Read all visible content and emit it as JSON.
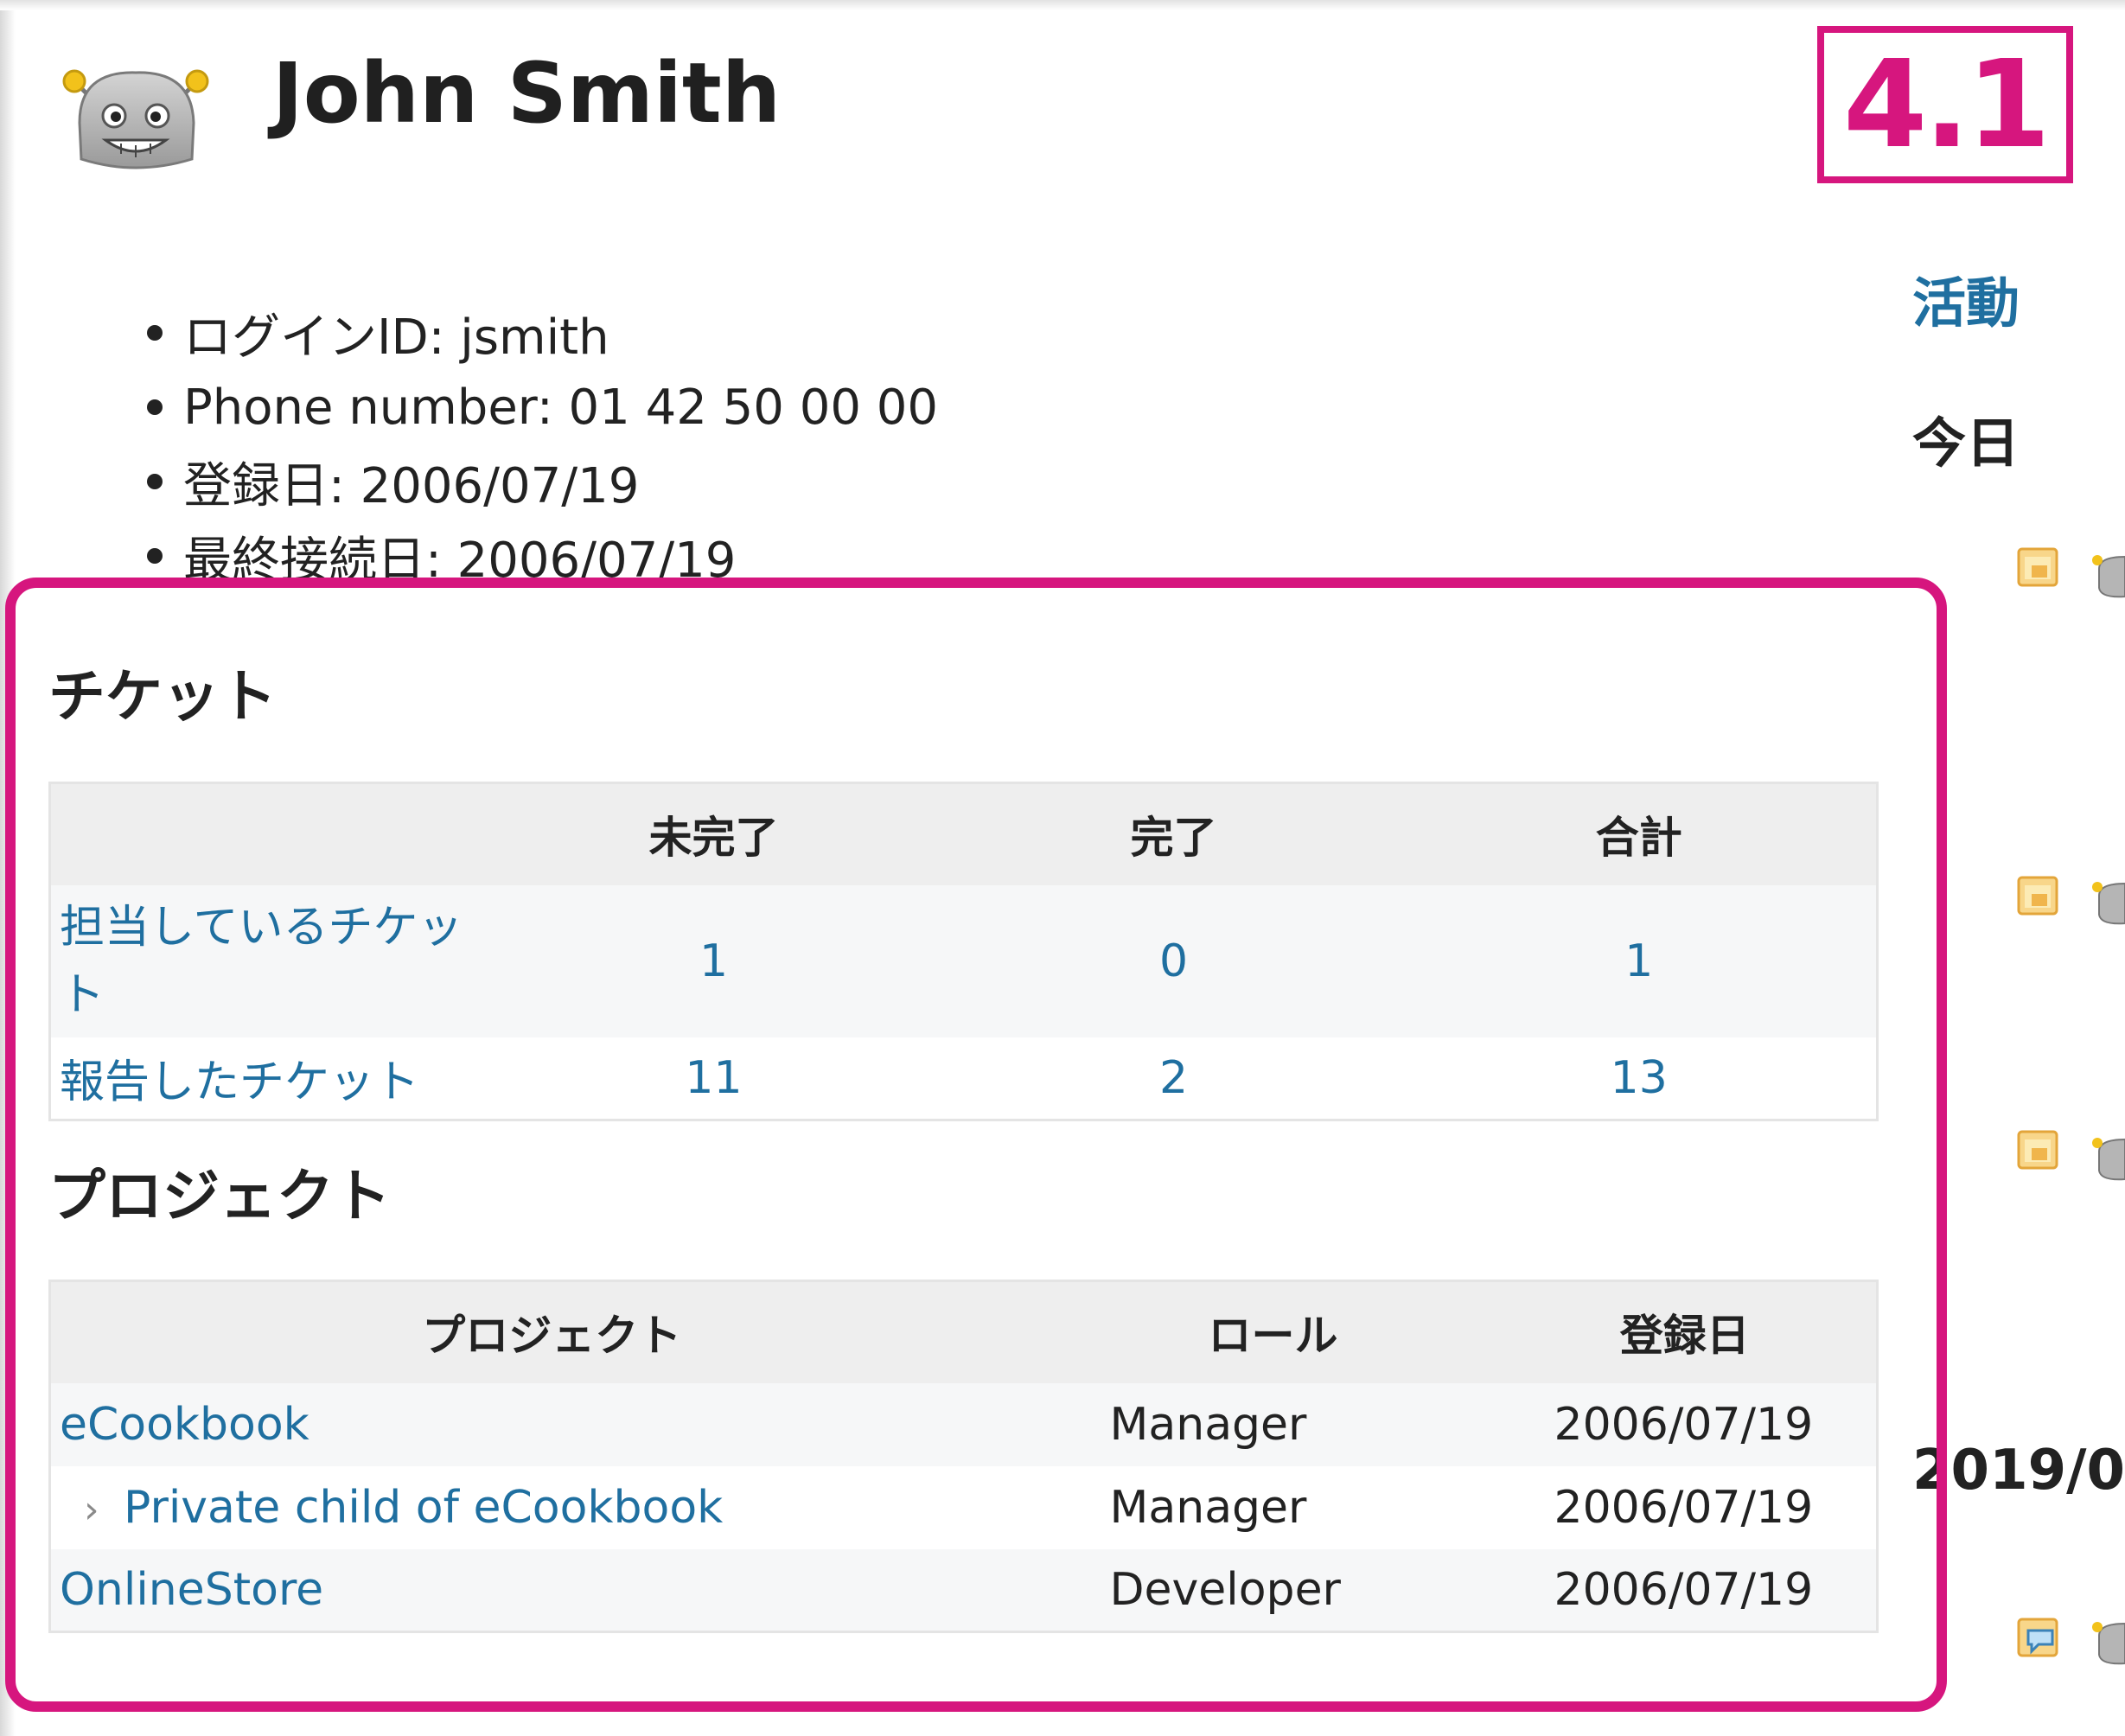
{
  "user": {
    "name": "John Smith",
    "info": [
      {
        "label": "ログインID: jsmith"
      },
      {
        "label": "Phone number: 01 42 50 00 00"
      },
      {
        "label": "登録日: 2006/07/19"
      },
      {
        "label": "最終接続日: 2006/07/19"
      }
    ]
  },
  "version_badge": "4.1",
  "sidebar": {
    "activity_link": "活動",
    "today_heading": "今日",
    "date_heading": "2019/0"
  },
  "issues": {
    "heading": "チケット",
    "columns": [
      "",
      "未完了",
      "完了",
      "合計"
    ],
    "rows": [
      {
        "label": "担当しているチケット",
        "open": "1",
        "closed": "0",
        "total": "1"
      },
      {
        "label": "報告したチケット",
        "open": "11",
        "closed": "2",
        "total": "13"
      }
    ]
  },
  "projects": {
    "heading": "プロジェクト",
    "columns": [
      "プロジェクト",
      "ロール",
      "登録日"
    ],
    "rows": [
      {
        "name": "eCookbook",
        "role": "Manager",
        "date": "2006/07/19"
      },
      {
        "name": "Private child of eCookbook",
        "role": "Manager",
        "date": "2006/07/19"
      },
      {
        "name": "OnlineStore",
        "role": "Developer",
        "date": "2006/07/19"
      }
    ]
  },
  "colors": {
    "accent": "#d6167e",
    "link": "#1f6fa0",
    "header_bg": "#eeeeee"
  },
  "icons": [
    "robot-avatar-icon",
    "issue-icon",
    "comment-icon",
    "chevron-right-icon"
  ]
}
